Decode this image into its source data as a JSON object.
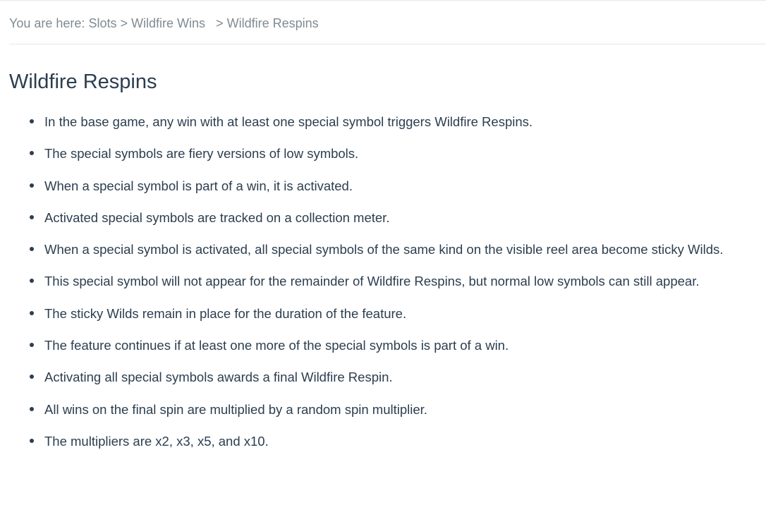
{
  "breadcrumb": {
    "prefix": "You are here:",
    "items": [
      "Slots",
      "Wildfire Wins",
      "Wildfire Respins"
    ],
    "separator": ">"
  },
  "page": {
    "title": "Wildfire Respins"
  },
  "rules": [
    "In the base game, any win with at least one special symbol triggers Wildfire Respins.",
    "The special symbols are fiery versions of low symbols.",
    "When a special symbol is part of a win, it is activated.",
    "Activated special symbols are tracked on a collection meter.",
    "When a special symbol is activated, all special symbols of the same kind on the visible reel area become sticky Wilds.",
    "This special symbol will not appear for the remainder of Wildfire Respins, but normal low symbols can still appear.",
    "The sticky Wilds remain in place for the duration of the feature.",
    "The feature continues if at least one more of the special symbols is part of a win.",
    "Activating all special symbols awards a final Wildfire Respin.",
    "All wins on the final spin are multiplied by a random spin multiplier.",
    "The multipliers are x2, x3, x5, and x10."
  ]
}
